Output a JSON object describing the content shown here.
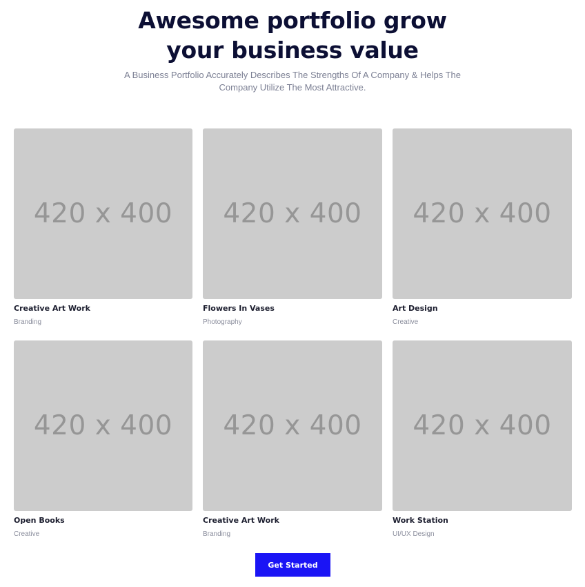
{
  "header": {
    "title_line1": "Awesome portfolio grow",
    "title_line2": "your business value",
    "subtitle": "A Business Portfolio Accurately Describes The Strengths Of A Company & Helps The Company Utilize The Most Attractive."
  },
  "portfolio": {
    "items": [
      {
        "placeholder": "420 x 400",
        "title": "Creative Art Work",
        "category": "Branding"
      },
      {
        "placeholder": "420 x 400",
        "title": "Flowers In Vases",
        "category": "Photography"
      },
      {
        "placeholder": "420 x 400",
        "title": "Art Design",
        "category": "Creative"
      },
      {
        "placeholder": "420 x 400",
        "title": "Open Books",
        "category": "Creative"
      },
      {
        "placeholder": "420 x 400",
        "title": "Creative Art Work",
        "category": "Branding"
      },
      {
        "placeholder": "420 x 400",
        "title": "Work Station",
        "category": "UI/UX Design"
      }
    ]
  },
  "cta": {
    "label": "Get Started",
    "color": "#1a14f5"
  },
  "colors": {
    "heading": "#0c0f34",
    "placeholder_bg": "#cccccc",
    "placeholder_text": "#969696"
  }
}
